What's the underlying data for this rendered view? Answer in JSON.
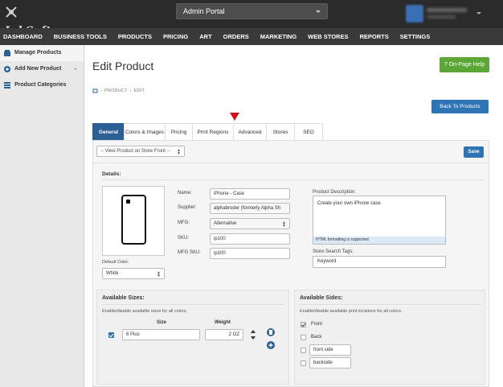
{
  "header": {
    "logo_text": "InkSoft",
    "portal_label": "Admin Portal"
  },
  "nav": {
    "items": [
      "DASHBOARD",
      "BUSINESS TOOLS",
      "PRODUCTS",
      "PRICING",
      "ART",
      "ORDERS",
      "MARKETING",
      "WEB STORES",
      "REPORTS",
      "SETTINGS"
    ]
  },
  "sidebar": {
    "items": [
      {
        "label": "Manage Products",
        "icon": "store-icon"
      },
      {
        "label": "Add New Product",
        "icon": "plus-circle-icon"
      },
      {
        "label": "Product Categories",
        "icon": "list-icon"
      }
    ]
  },
  "page": {
    "title": "Edit Product",
    "help_label": "? On-Page Help",
    "breadcrumb": [
      "PRODUCT",
      "EDIT"
    ],
    "back_label": "Back To Products"
  },
  "tabs": [
    "General",
    "Colors & Images",
    "Pricing",
    "Print Regions",
    "Advanced",
    "Stores",
    "SEO"
  ],
  "toolbar": {
    "view_selected": "-- View Product on Store Front --",
    "save_label": "Save"
  },
  "details": {
    "heading": "Details:",
    "default_color_label": "Default Color:",
    "default_color_value": "White",
    "fields": [
      {
        "label": "Name:",
        "value": "iPhone - Case"
      },
      {
        "label": "Supplier:",
        "value": "alphabroder (formerly Alpha Sh"
      },
      {
        "label": "MFG:",
        "value": "Alternative"
      },
      {
        "label": "SKU:",
        "value": "ip100"
      },
      {
        "label": "MFG SKU:",
        "value": "ip100"
      }
    ],
    "description_label": "Product Description:",
    "description_value": "Create your own iPhone case",
    "description_hint": "HTML formatting is supported",
    "tags_label": "Store Search Tags:",
    "tags_value": "Keyword"
  },
  "sizes": {
    "title": "Available Sizes:",
    "desc": "Enable/disable available sizes for all colors.",
    "col_size": "Size",
    "col_weight": "Weight",
    "rows": [
      {
        "size": "6 Plus",
        "weight": "2 OZ"
      }
    ]
  },
  "sides": {
    "title": "Available Sides:",
    "desc": "Enable/disable available print locations for all colors.",
    "items": [
      {
        "label": "Front"
      },
      {
        "label": "Back"
      },
      {
        "label": "front side"
      },
      {
        "label": "backside"
      }
    ]
  },
  "colors": {
    "topbar": "#2b2b2b",
    "nav": "#3a3a3a",
    "primary": "#2f74b5",
    "tab_active": "#2c5f94",
    "help": "#5ca637",
    "arrow": "#d0131b"
  }
}
